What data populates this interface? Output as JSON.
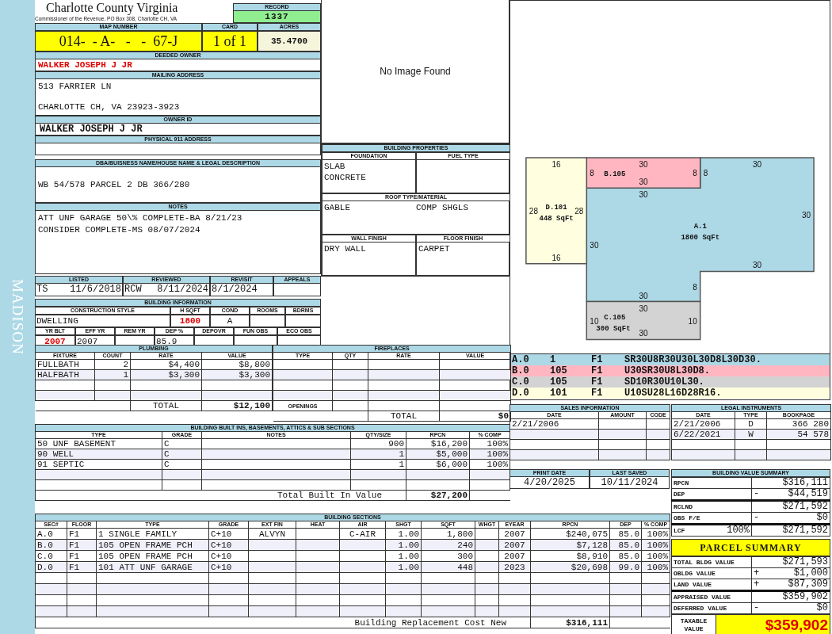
{
  "district": "MADISON",
  "header": {
    "title": "Charlotte County Virginia",
    "subtitle": "Commissioner of the Revenue, PO Box 308, Charlotte CH, VA",
    "record_label": "RECORD",
    "record": "1337"
  },
  "parcel_ids": [
    {
      "kind": "map",
      "label": "MAP NUMBER",
      "value": "014-  - A-   -   -  67-J"
    },
    {
      "kind": "card",
      "label": "CARD",
      "value": "1 of 1"
    },
    {
      "kind": "acres",
      "label": "ACRES",
      "value": "35.4700"
    }
  ],
  "owner_sections": [
    {
      "kind": "owner",
      "label": "DEEDED OWNER",
      "lines": [
        "WALKER JOSEPH J JR"
      ]
    },
    {
      "kind": "address",
      "label": "MAILING ADDRESS",
      "lines": [
        "513 FARRIER LN",
        "CHARLOTTE CH, VA 23923-3923"
      ]
    },
    {
      "kind": "owner_id",
      "label": "OWNER ID",
      "lines": [
        "WALKER JOSEPH J JR"
      ]
    },
    {
      "kind": "plain",
      "label": "PHYSICAL 911 ADDRESS"
    },
    {
      "kind": "legal",
      "label": "DBA/BUISNESS NAME/HOUSE NAME & LEGAL DESCRIPTION",
      "lines": [
        "WB 54/578 PARCEL 2 DB 366/280"
      ]
    },
    {
      "kind": "notes",
      "label": "NOTES",
      "lines": [
        "ATT UNF GARAGE 50\\% COMPLETE-BA 8/21/23",
        "CONSIDER COMPLETE-MS 08/07/2024"
      ]
    }
  ],
  "review": [
    {
      "label": "LISTED",
      "by": "TS",
      "date": "11/6/2018"
    },
    {
      "label": "REVIEWED",
      "by": "RCW",
      "date": "8/11/2024"
    },
    {
      "label": "REVISIT",
      "date": "8/1/2024"
    },
    {
      "label": "APPEALS"
    }
  ],
  "building_info": {
    "title": "BUILDING INFORMATION",
    "construction": [
      {
        "label": "CONSTRUCTION STYLE",
        "value": "DWELLING",
        "highlight": false
      },
      {
        "label": "H SQFT",
        "value": "1800",
        "highlight": true
      },
      {
        "label": "COND",
        "value": "A",
        "highlight": false
      },
      {
        "label": "ROOMS"
      },
      {
        "label": "BDRMS"
      }
    ],
    "age": [
      {
        "label": "YR BLT",
        "value": "2007",
        "highlight": true
      },
      {
        "label": "EFF YR",
        "value": "2007",
        "highlight": false
      },
      {
        "label": "REM YR"
      },
      {
        "label": "DEP %",
        "value": "85.9",
        "highlight": false
      },
      {
        "label": "DEPOVR"
      },
      {
        "label": "FUN OBS"
      },
      {
        "label": "ECO OBS"
      }
    ]
  },
  "image": {
    "message": "No Image Found"
  },
  "building_properties": {
    "title": "BUILDING PROPERTIES",
    "items": [
      {
        "kind": "single",
        "label": "FOUNDATION",
        "lines": [
          "SLAB",
          "CONCRETE"
        ]
      },
      {
        "kind": "single",
        "label": "FUEL TYPE"
      },
      {
        "kind": "pair",
        "label": "ROOF TYPE/MATERIAL",
        "lines": [
          "GABLE",
          "COMP SHGLS"
        ]
      },
      {
        "kind": "single",
        "label": "WALL FINISH",
        "lines": [
          "DRY WALL"
        ]
      },
      {
        "kind": "single",
        "label": "FLOOR FINISH",
        "lines": [
          "CARPET"
        ]
      }
    ]
  },
  "sketch": {
    "areas": [
      {
        "section": "A.0",
        "code": "1",
        "floor": "F1",
        "vector": "SR30U8R30U30L30D8L30D30.",
        "color": "#add8e6",
        "label": "A.1",
        "size": "1800 SqFt",
        "sides": [
          "30",
          "8",
          "30",
          "30",
          "30",
          "8",
          "30",
          "30"
        ]
      },
      {
        "section": "B.0",
        "code": "105",
        "floor": "F1",
        "vector": "U30SR30U8L30D8.",
        "color": "#ffb6c1",
        "label": "B.105",
        "sides": [
          "30",
          "8",
          "30",
          "8"
        ]
      },
      {
        "section": "C.0",
        "code": "105",
        "floor": "F1",
        "vector": "SD10R30U10L30.",
        "color": "#d3d3d3",
        "label": "C.105",
        "size": "300 SqFt",
        "sides": [
          "10",
          "30",
          "10",
          "30"
        ]
      },
      {
        "section": "D.0",
        "code": "101",
        "floor": "F1",
        "vector": "U10SU28L16D28R16.",
        "color": "#ffffe0",
        "label": "D.101",
        "size": "448 SqFt",
        "sides": [
          "28",
          "16",
          "28",
          "16"
        ]
      }
    ]
  },
  "plumbing": {
    "title": "PLUMBING",
    "columns": [
      "FIXTURE",
      "COUNT",
      "RATE",
      "VALUE"
    ],
    "rows": [
      [
        "FULLBATH",
        "2",
        "$4,400",
        "$8,800"
      ],
      [
        "HALFBATH",
        "1",
        "$3,300",
        "$3,300"
      ]
    ],
    "footer": {
      "label": "TOTAL",
      "value": "$12,100"
    }
  },
  "fireplaces": {
    "title": "FIREPLACES",
    "columns": [
      "TYPE",
      "QTY",
      "RATE",
      "VALUE"
    ],
    "openings": "OPENINGS",
    "footer": {
      "label": "TOTAL",
      "value": "$0"
    }
  },
  "built_ins": {
    "title": "BUILDING BUILT INS, BASEMENTS, ATTICS & SUB SECTIONS",
    "columns": [
      "TYPE",
      "GRADE",
      "NOTES",
      "QTY/SIZE",
      "RPCN",
      "% COMP"
    ],
    "rows": [
      [
        "50 UNF BASEMENT",
        "C",
        null,
        "900",
        "$16,200",
        "100%"
      ],
      [
        "90 WELL",
        "C",
        null,
        "1",
        "$5,000",
        "100%"
      ],
      [
        "91 SEPTIC",
        "C",
        null,
        "1",
        "$6,000",
        "100%"
      ]
    ],
    "footer": {
      "label": "Total Built In Value",
      "value": "$27,200"
    }
  },
  "building_sections": {
    "title": "BUILDING SECTIONS",
    "columns": [
      "SEC#",
      "FLOOR",
      "TYPE",
      "GRADE",
      "EXT FIN",
      "HEAT",
      "AIR",
      "SHGT",
      "SQFT",
      "WHGT",
      "EYEAR",
      "RPCN",
      "DEP",
      "% COMP"
    ],
    "rows": [
      [
        "A.0",
        "F1",
        "1 SINGLE FAMILY",
        "C+10",
        "ALVYN",
        null,
        "C-AIR",
        "1.00",
        "1,800",
        null,
        "2007",
        "$240,075",
        "85.0",
        "100%"
      ],
      [
        "B.0",
        "F1",
        "105 OPEN FRAME PCH",
        "C+10",
        null,
        null,
        null,
        "1.00",
        "240",
        null,
        "2007",
        "$7,128",
        "85.0",
        "100%"
      ],
      [
        "C.0",
        "F1",
        "105 OPEN FRAME PCH",
        "C+10",
        null,
        null,
        null,
        "1.00",
        "300",
        null,
        "2007",
        "$8,910",
        "85.0",
        "100%"
      ],
      [
        "D.0",
        "F1",
        "101 ATT UNF GARAGE",
        "C+10",
        null,
        null,
        null,
        "1.00",
        "448",
        null,
        "2023",
        "$20,698",
        "99.0",
        "100%"
      ]
    ],
    "footer": {
      "label": "Building Replacement Cost New",
      "value": "$316,111"
    }
  },
  "sales": {
    "title": "SALES INFORMATION",
    "columns": [
      "DATE",
      "AMOUNT",
      "CODE"
    ],
    "rows": [
      [
        "2/21/2006",
        null,
        null
      ]
    ]
  },
  "legal_instruments": {
    "title": "LEGAL INSTRUMENTS",
    "columns": [
      "DATE",
      "TYPE",
      "BOOKPAGE"
    ],
    "rows": [
      [
        "2/21/2006",
        "D",
        "366 280"
      ],
      [
        "6/22/2021",
        "W",
        "54 578"
      ]
    ]
  },
  "dates": [
    {
      "label": "PRINT DATE",
      "value": "4/20/2025"
    },
    {
      "label": "LAST SAVED",
      "value": "10/11/2024"
    }
  ],
  "value_summary": {
    "title": "BUILDING VALUE SUMMARY",
    "rows": [
      {
        "kind": "line",
        "label": "RPCN",
        "value": "$316,111"
      },
      {
        "kind": "line",
        "label": "DEP",
        "sign": "-",
        "value": "$44,519"
      },
      {
        "kind": "subtotal",
        "label": "RCLND",
        "value": "$271,592"
      },
      {
        "kind": "line",
        "label": "OBS F/E",
        "sign": "-",
        "value": "$0"
      },
      {
        "kind": "subtotal",
        "label": "LCF",
        "rate": "100%",
        "value": "$271,592"
      }
    ]
  },
  "parcel_summary": {
    "title": "PARCEL SUMMARY",
    "rows": [
      {
        "kind": "line",
        "label": "TOTAL BLDG VALUE",
        "value": "$271,593"
      },
      {
        "kind": "line",
        "label": "OBLDG VALUE",
        "sign": "+",
        "value": "$1,000"
      },
      {
        "kind": "line",
        "label": "LAND VALUE",
        "sign": "+",
        "value": "$87,309"
      },
      {
        "kind": "subtotal",
        "label": "APPRAISED VALUE",
        "value": "$359,902"
      },
      {
        "kind": "line",
        "label": "DEFERRED VALUE",
        "sign": "-",
        "value": "$0"
      }
    ],
    "taxable": {
      "label": "TAXABLE VALUE",
      "value": "$359,902"
    }
  }
}
